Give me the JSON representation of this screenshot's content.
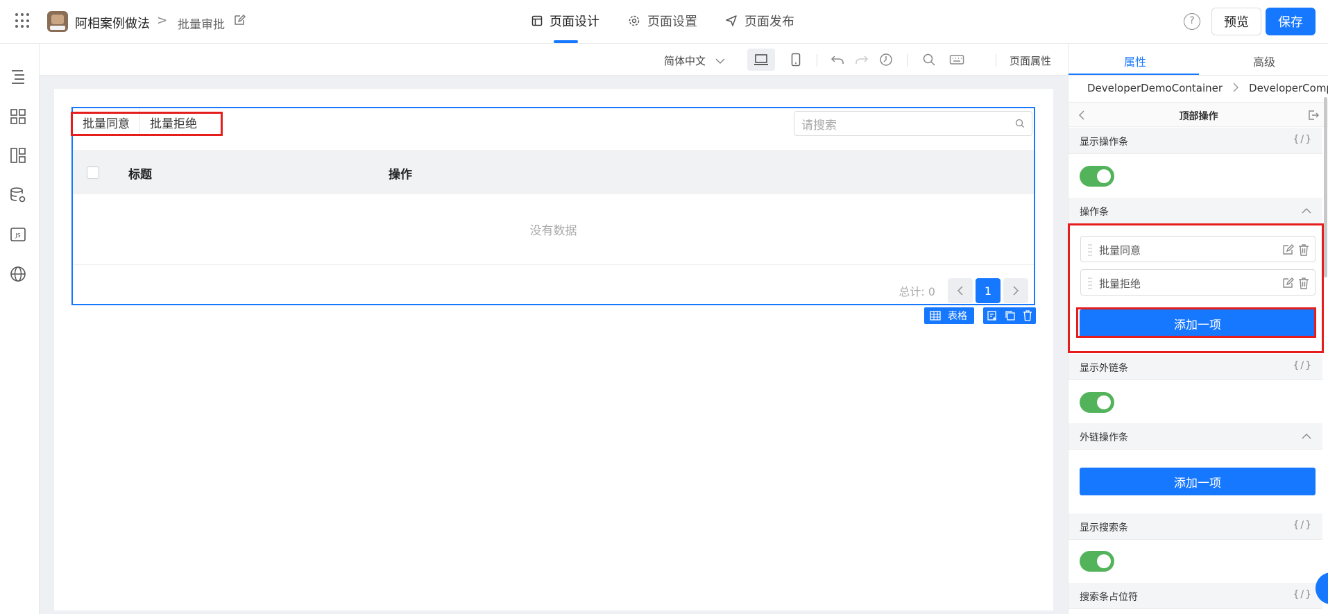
{
  "header": {
    "app_name": "阿相案例做法",
    "breadcrumb_sep": ">",
    "page_name": "批量审批",
    "tabs": [
      {
        "label": "页面设计",
        "icon": "layout-icon",
        "active": true
      },
      {
        "label": "页面设置",
        "icon": "gear-icon",
        "active": false
      },
      {
        "label": "页面发布",
        "icon": "send-icon",
        "active": false
      }
    ],
    "help": "?",
    "preview_label": "预览",
    "save_label": "保存"
  },
  "toolbar": {
    "language": "简体中文",
    "page_properties": "页面属性"
  },
  "table": {
    "operations": [
      "批量同意",
      "批量拒绝"
    ],
    "search_placeholder": "请搜索",
    "columns": [
      "标题",
      "操作"
    ],
    "empty_text": "没有数据",
    "total_label": "总计: 0",
    "current_page": "1",
    "component_label": "表格"
  },
  "panel": {
    "tabs": [
      "属性",
      "高级"
    ],
    "breadcrumb": [
      "DeveloperDemoContainer",
      "DeveloperCompone"
    ],
    "section_title": "顶部操作",
    "code_glyph": "{/}",
    "show_toolbar": {
      "label": "显示操作条",
      "enabled": true
    },
    "toolbar_section": "操作条",
    "toolbar_items": [
      "批量同意",
      "批量拒绝"
    ],
    "add_item_label": "添加一项",
    "show_link_bar": {
      "label": "显示外链条",
      "enabled": true
    },
    "link_section": "外链操作条",
    "add_link_label": "添加一项",
    "show_search": {
      "label": "显示搜索条",
      "enabled": true
    },
    "search_placeholder_label": "搜索条占位符"
  },
  "colors": {
    "accent": "#1677ff",
    "toggle_on": "#52b35a",
    "highlight": "#e51d1d"
  }
}
